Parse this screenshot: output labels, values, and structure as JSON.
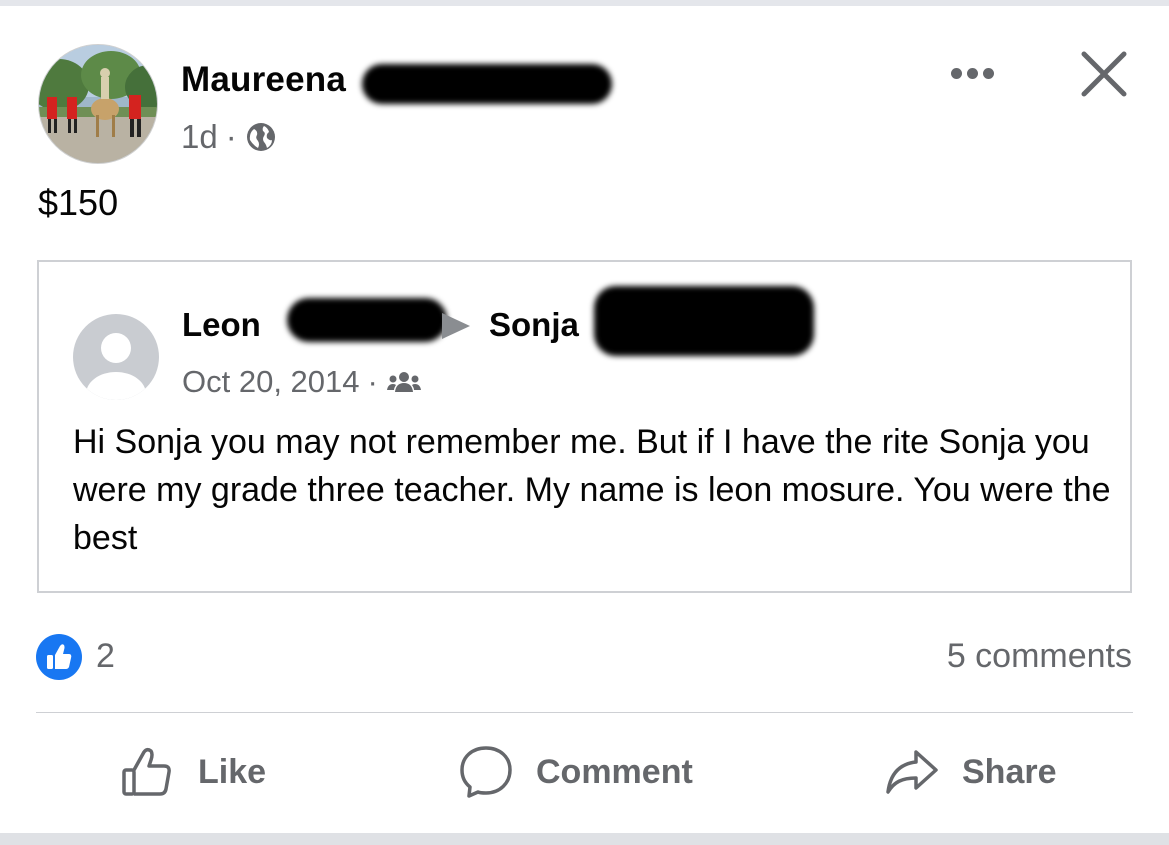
{
  "post": {
    "author_name": "Maureena",
    "time": "1d",
    "separator": "·",
    "privacy_icon": "globe-icon",
    "text": "$150"
  },
  "header_actions": {
    "more_icon": "more-options-icon",
    "close_icon": "close-icon"
  },
  "shared_post": {
    "author": "Leon",
    "target": "Sonja",
    "date": "Oct 20, 2014",
    "separator": "·",
    "audience_icon": "friends-icon",
    "body": "Hi Sonja you may not remember me. But if I have the rite Sonja you were my grade three teacher.  My name is leon mosure. You were the best"
  },
  "reactions": {
    "like_count": "2",
    "comments": "5 comments"
  },
  "actions": {
    "like": "Like",
    "comment": "Comment",
    "share": "Share"
  },
  "colors": {
    "accent": "#1877f2",
    "secondary_text": "#65676b",
    "redaction": "#000000"
  }
}
